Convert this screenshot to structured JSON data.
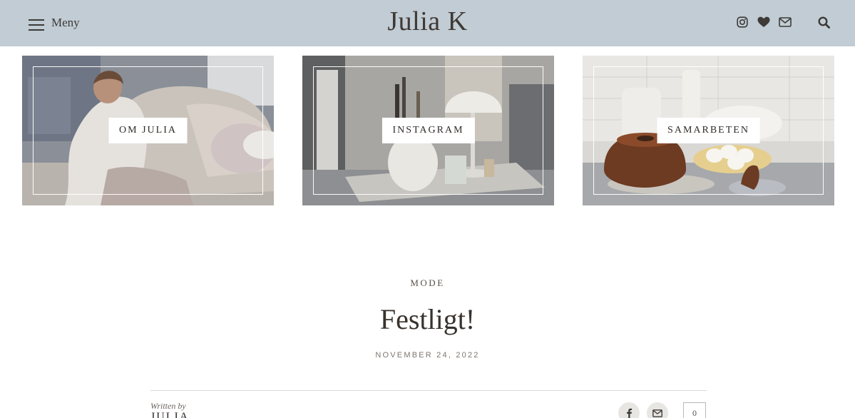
{
  "header": {
    "menu_label": "Meny",
    "site_title": "Julia K",
    "icons": [
      "instagram-icon",
      "heart-icon",
      "mail-icon",
      "search-icon"
    ]
  },
  "tiles": [
    {
      "label": "OM JULIA",
      "image": "woman-on-sofa"
    },
    {
      "label": "INSTAGRAM",
      "image": "desk-with-vase-and-lamp"
    },
    {
      "label": "SAMARBETEN",
      "image": "bundt-cake-and-eggs"
    }
  ],
  "post": {
    "category": "MODE",
    "title": "Festligt!",
    "date": "NOVEMBER 24, 2022",
    "written_by": "Written by",
    "author": "JULIA",
    "comment_count": "0"
  },
  "colors": {
    "header_bg": "#c1ccd4",
    "text_dark": "#3b3530",
    "divider": "#dcd8d4"
  }
}
